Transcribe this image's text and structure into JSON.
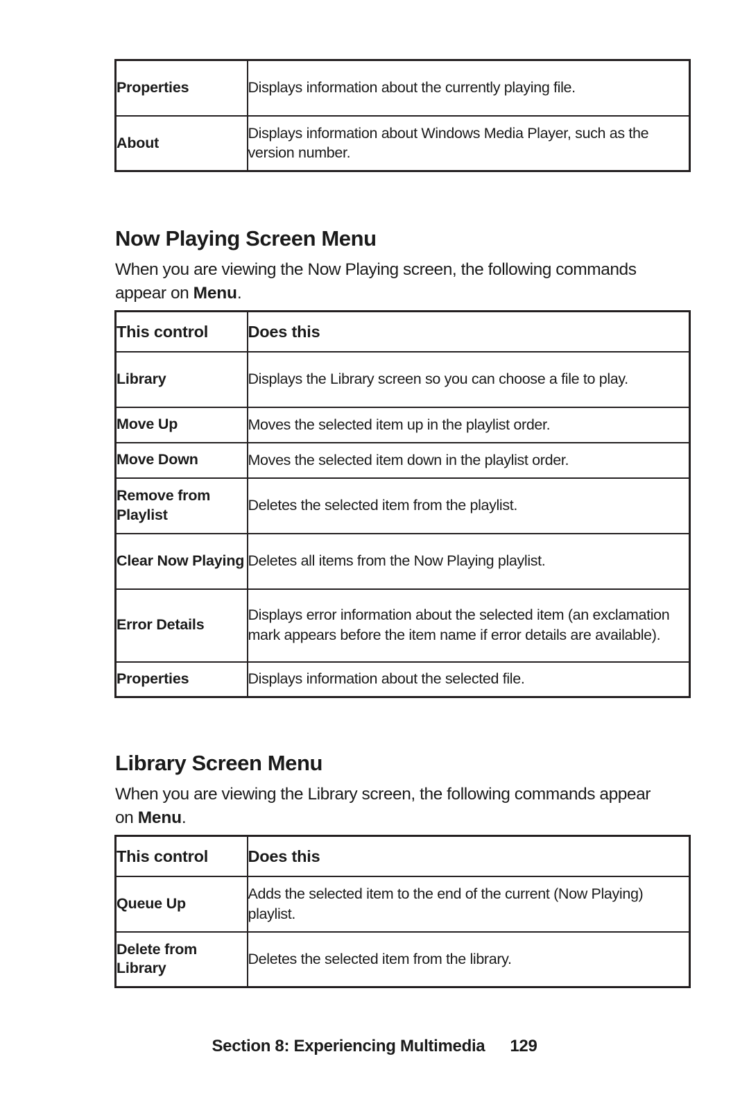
{
  "page": {
    "footer_section": "Section 8: Experiencing Multimedia",
    "footer_page_number": "129",
    "text_color": "#1a1a1a",
    "rule_color": "#231f20",
    "background": "#ffffff"
  },
  "table_top": {
    "rows": [
      {
        "control": "Properties",
        "description": "Displays information about the currently playing file."
      },
      {
        "control": "About",
        "description": "Displays information about Windows Media Player, such as the version number."
      }
    ]
  },
  "section_now_playing": {
    "heading": "Now Playing Screen Menu",
    "intro_before": "When you are viewing the Now Playing screen, the following commands appear on ",
    "intro_bold": "Menu",
    "intro_after": ".",
    "table": {
      "headers": [
        "This control",
        "Does this"
      ],
      "rows": [
        {
          "control": "Library",
          "description": "Displays the Library screen so you can choose a file to play."
        },
        {
          "control": "Move Up",
          "description": "Moves the selected item up in the playlist order."
        },
        {
          "control": "Move Down",
          "description": "Moves the selected item down in the playlist order."
        },
        {
          "control": "Remove from Playlist",
          "description": "Deletes the selected item from the playlist."
        },
        {
          "control": "Clear Now Playing",
          "description": "Deletes all items from the Now Playing playlist."
        },
        {
          "control": "Error Details",
          "description": "Displays error information about the selected item (an exclamation mark appears before the item name if error details are available)."
        },
        {
          "control": "Properties",
          "description": "Displays information about the selected file."
        }
      ]
    }
  },
  "section_library": {
    "heading": "Library Screen Menu",
    "intro_before": "When you are viewing the Library screen, the following commands appear on ",
    "intro_bold": "Menu",
    "intro_after": ".",
    "table": {
      "headers": [
        "This control",
        "Does this"
      ],
      "rows": [
        {
          "control": "Queue Up",
          "description": "Adds the selected item to the end of the current (Now Playing) playlist."
        },
        {
          "control": "Delete from Library",
          "description": "Deletes the selected item from the library."
        }
      ]
    }
  }
}
